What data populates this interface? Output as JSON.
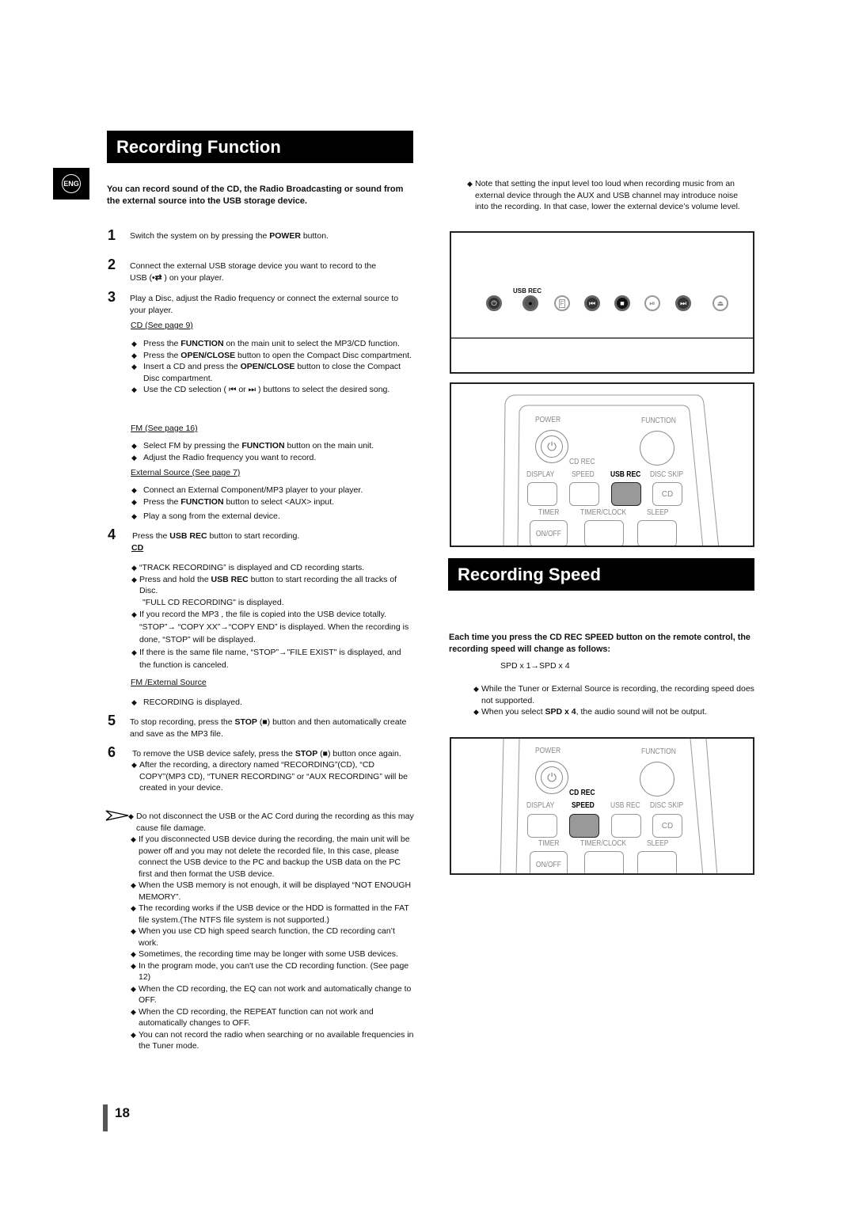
{
  "recording_function": {
    "title": "Recording Function",
    "lang_badge": "ENG",
    "intro": "You can record sound of the CD, the Radio Broadcasting or sound from the external source into the USB storage device.",
    "steps": [
      {
        "num": "1",
        "parts": [
          "Switch the system on by pressing the ",
          "POWER",
          "  button."
        ]
      },
      {
        "num": "2",
        "line1": "Connect the external USB storage device you want to record to the",
        "line2_pre": "USB (",
        "line2_post": "  ) on your player."
      },
      {
        "num": "3",
        "text": "Play a Disc, adjust the Radio frequency or connect the external source to your player."
      }
    ],
    "cd_heading": "CD (See page 9)",
    "cd_bullets": [
      {
        "pre": "Press the ",
        "bold": "FUNCTION",
        "post": " on the main unit to select the MP3/CD function."
      },
      {
        "pre": "Press the ",
        "bold": "OPEN/CLOSE",
        "post": " button to open the Compact Disc compartment."
      },
      {
        "pre": "Insert a CD and press the ",
        "bold": "OPEN/CLOSE",
        "post": " button to close the Compact Disc compartment."
      },
      {
        "pre": "Use the CD selection ( ⏮ or ⏭ ) buttons to select the desired song.",
        "bold": "",
        "post": ""
      }
    ],
    "fm_heading": "FM (See page 16)",
    "fm_bullets": [
      {
        "pre": "Select FM by pressing the ",
        "bold": "FUNCTION",
        "post": " button on the main unit."
      },
      {
        "pre": "Adjust the Radio frequency you want to record.",
        "bold": "",
        "post": ""
      }
    ],
    "ext_heading": "External Source (See page 7)",
    "ext_bullets": [
      {
        "pre": "Connect an External Component/MP3 player to your player.",
        "bold": "",
        "post": ""
      },
      {
        "pre": "Press the ",
        "bold": "FUNCTION",
        "post": " button to select <AUX> input."
      },
      {
        "pre": "Play a song from the external device.",
        "bold": "",
        "post": ""
      }
    ],
    "step4": {
      "num": "4",
      "pre": "Press the ",
      "bold": "USB REC",
      "post": " button to start recording."
    },
    "step4_cd_heading": "CD",
    "step4_cd_bullets": [
      {
        "pre": "“TRACK RECORDING” is displayed and CD recording starts.",
        "bold": "",
        "post": ""
      },
      {
        "pre": "Press and hold the ",
        "bold": "USB REC",
        "post": " button to start recording the all tracks of Disc."
      }
    ],
    "full_cd_note": "\"FULL CD RECORDING\" is displayed.",
    "step4_cd_bullets2": [
      {
        "pre": "If you record the MP3 , the file is copied into the USB device totally. “STOP”→ “COPY XX”→“COPY END” is displayed.  When the recording is done, “STOP” will be displayed."
      },
      {
        "pre": "If there is the same file name, “STOP”→\"FILE EXIST\" is displayed, and the function is canceled."
      }
    ],
    "fm_ext_heading": "FM /External Source",
    "fm_ext_bullet": "RECORDING is displayed.",
    "step5": {
      "num": "5",
      "pre": "To stop recording, press the ",
      "bold": "STOP",
      "post": " (■) button and then automatically create and save as the MP3 file."
    },
    "step6": {
      "num": "6",
      "pre": "To remove the USB device safely, press the ",
      "bold": "STOP",
      "post": " (■) button once again."
    },
    "step6_bullet": "After the recording, a directory named “RECORDING”(CD), “CD COPY”(MP3 CD), “TUNER RECORDING” or “AUX RECORDING” will be created in your device.",
    "notes": [
      "Do not disconnect the USB or the AC Cord during the recording as this may cause file damage.",
      "If you disconnected USB device during the recording, the main unit will be power off and you may not delete the recorded file, In this case, please connect the USB device to the PC and backup the USB data on the PC first and then format the USB device.",
      "When the USB memory is not enough, it will be displayed “NOT ENOUGH MEMORY”.",
      "The recording works if the USB device or the HDD is formatted in the FAT file system.(The NTFS file system is not supported.)",
      "When you use CD high speed search function, the CD recording can’t work.",
      "Sometimes, the recording time may be longer with some USB devices.",
      "In the program mode, you can't use the CD recording function. (See page 12)",
      "When the CD recording, the EQ  can not work and automatically change to OFF.",
      "When the CD recording, the REPEAT function can not work and automatically changes to OFF.",
      "You can not record the radio when searching or  no available frequencies in the Tuner mode."
    ]
  },
  "right_note": "Note that setting the input level too loud when recording music from an external device through the AUX and USB channel may introduce noise into the recording. In that case, lower the external device’s volume level.",
  "front_panel": {
    "usb_rec_label": "USB REC",
    "buttons": [
      {
        "name": "power",
        "glyph": "⏻",
        "style": "dark"
      },
      {
        "name": "usb-rec",
        "glyph": "●",
        "style": "dark"
      },
      {
        "name": "function",
        "glyph": "F",
        "style": "light"
      },
      {
        "name": "previous",
        "glyph": "⏮",
        "style": "dark"
      },
      {
        "name": "stop",
        "glyph": "■",
        "style": "dark"
      },
      {
        "name": "play-pause",
        "glyph": "⏯",
        "style": "light"
      },
      {
        "name": "next",
        "glyph": "⏭",
        "style": "dark"
      },
      {
        "name": "eject",
        "glyph": "⏏",
        "style": "light"
      }
    ]
  },
  "remote": {
    "power": "POWER",
    "function": "FUNCTION",
    "cd_rec": "CD REC",
    "display": "DISPLAY",
    "speed": "SPEED",
    "usb_rec": "USB REC",
    "disc_skip": "DISC SKIP",
    "cd": "CD",
    "timer": "TIMER",
    "timer_clock": "TIMER/CLOCK",
    "sleep": "SLEEP",
    "on_off": "ON/OFF"
  },
  "recording_speed": {
    "title": "Recording Speed",
    "intro": "Each time you press the CD REC SPEED button on the remote control, the recording speed will change as follows:",
    "sequence": "SPD x 1→SPD x 4",
    "bullets": [
      {
        "pre": "While the Tuner or External Source is recording, the recording speed does not supported.",
        "bold": "",
        "post": ""
      },
      {
        "pre": "When you select ",
        "bold": "SPD x 4",
        "post": ", the audio sound will not be output."
      }
    ]
  },
  "page_number": "18"
}
